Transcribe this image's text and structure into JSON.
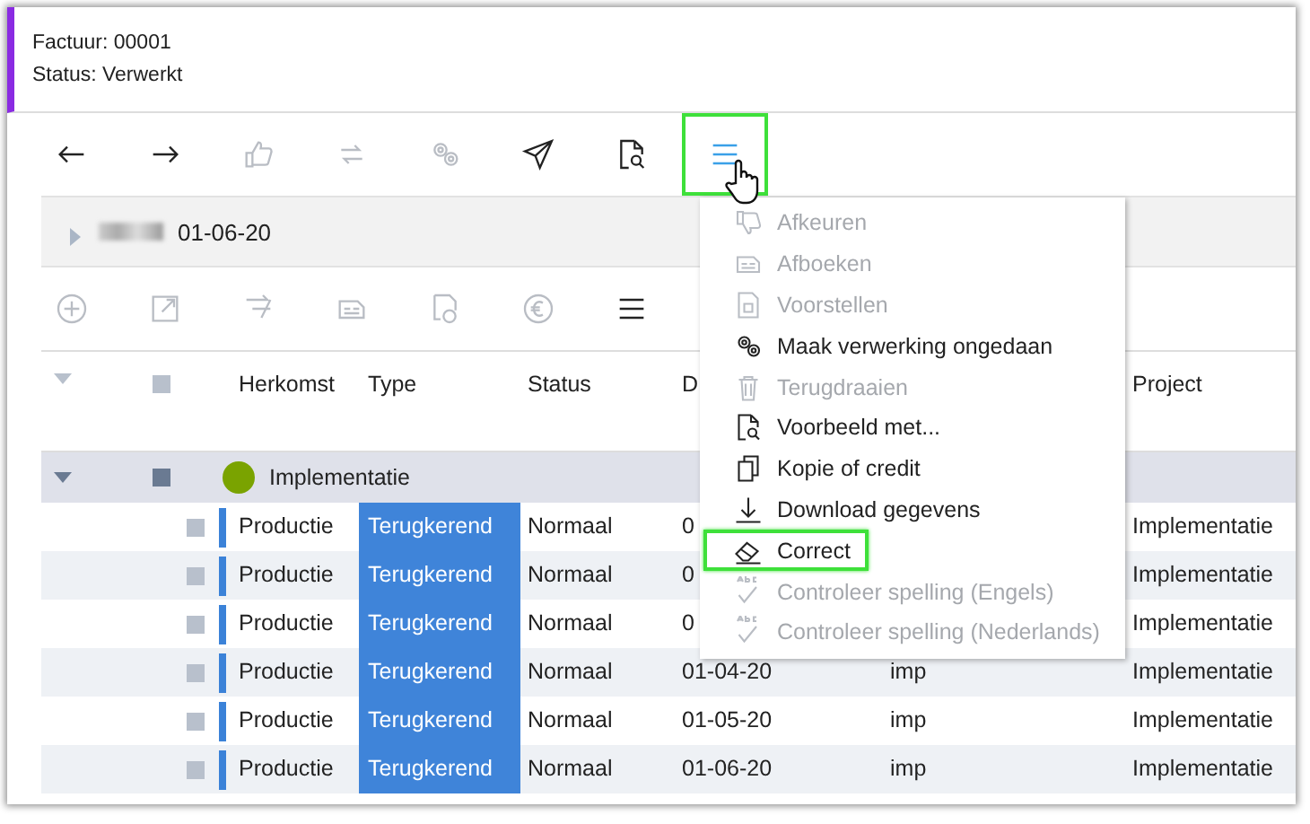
{
  "header": {
    "title": "Factuur: 00001",
    "status": "Status: Verwerkt"
  },
  "toolbar": [
    {
      "kind": "arrow-left",
      "disabled": false,
      "highlighted": false
    },
    {
      "kind": "arrow-right",
      "disabled": false,
      "highlighted": false
    },
    {
      "kind": "thumbs-up",
      "disabled": true,
      "highlighted": false
    },
    {
      "kind": "swap",
      "disabled": true,
      "highlighted": false
    },
    {
      "kind": "gears",
      "disabled": true,
      "highlighted": false
    },
    {
      "kind": "send",
      "disabled": false,
      "highlighted": false
    },
    {
      "kind": "preview",
      "disabled": false,
      "highlighted": false
    },
    {
      "kind": "menu",
      "disabled": false,
      "highlighted": true
    }
  ],
  "panel": {
    "expanded": false,
    "date": "01-06-20"
  },
  "subtoolbar": [
    {
      "kind": "plus-circle",
      "disabled": true
    },
    {
      "kind": "external",
      "disabled": true
    },
    {
      "kind": "lines-arrow",
      "disabled": true
    },
    {
      "kind": "doc-lines",
      "disabled": true
    },
    {
      "kind": "doc-refresh",
      "disabled": true
    },
    {
      "kind": "euro-circle",
      "disabled": true
    },
    {
      "kind": "menu",
      "disabled": false
    }
  ],
  "table": {
    "select_all": {
      "checked": false
    },
    "columns": [
      "Herkomst",
      "Type",
      "Status",
      "D",
      "Project"
    ],
    "group": {
      "label": "Implementatie",
      "color": "#7aa300",
      "expanded": true,
      "checked": false
    },
    "rows": [
      {
        "checked": false,
        "origin": "Productie",
        "type": "Terugkerend",
        "status": "Normaal",
        "date": "0",
        "project": "Implementatie"
      },
      {
        "checked": false,
        "origin": "Productie",
        "type": "Terugkerend",
        "status": "Normaal",
        "date": "0",
        "project": "Implementatie"
      },
      {
        "checked": false,
        "origin": "Productie",
        "type": "Terugkerend",
        "status": "Normaal",
        "date": "0",
        "project": "Implementatie"
      },
      {
        "checked": false,
        "origin": "Productie",
        "type": "Terugkerend",
        "status": "Normaal",
        "date": "01-04-20",
        "column_5": "imp",
        "project": "Implementatie"
      },
      {
        "checked": false,
        "origin": "Productie",
        "type": "Terugkerend",
        "status": "Normaal",
        "date": "01-05-20",
        "column_5": "imp",
        "project": "Implementatie"
      },
      {
        "checked": false,
        "origin": "Productie",
        "type": "Terugkerend",
        "status": "Normaal",
        "date": "01-06-20",
        "column_5": "imp",
        "project": "Implementatie"
      }
    ]
  },
  "menu": [
    {
      "label": "Afkeuren",
      "kind": "thumbs-down",
      "disabled": true,
      "highlighted": false
    },
    {
      "label": "Afboeken",
      "kind": "doc-lines",
      "disabled": true,
      "highlighted": false
    },
    {
      "label": "Voorstellen",
      "kind": "doc",
      "disabled": true,
      "highlighted": false
    },
    {
      "label": "Maak verwerking ongedaan",
      "kind": "gears",
      "disabled": false,
      "highlighted": false
    },
    {
      "label": "Terugdraaien",
      "kind": "trash",
      "disabled": true,
      "highlighted": false
    },
    {
      "label": "Voorbeeld met...",
      "kind": "preview",
      "disabled": false,
      "highlighted": false
    },
    {
      "label": "Kopie of credit",
      "kind": "copy",
      "disabled": false,
      "highlighted": false
    },
    {
      "label": "Download gegevens",
      "kind": "download",
      "disabled": false,
      "highlighted": false
    },
    {
      "label": "Correct",
      "kind": "eraser",
      "disabled": false,
      "highlighted": true
    },
    {
      "label": "Controleer spelling (Engels)",
      "kind": "spell",
      "disabled": true,
      "highlighted": false
    },
    {
      "label": "Controleer spelling (Nederlands)",
      "kind": "spell",
      "disabled": true,
      "highlighted": false
    }
  ]
}
